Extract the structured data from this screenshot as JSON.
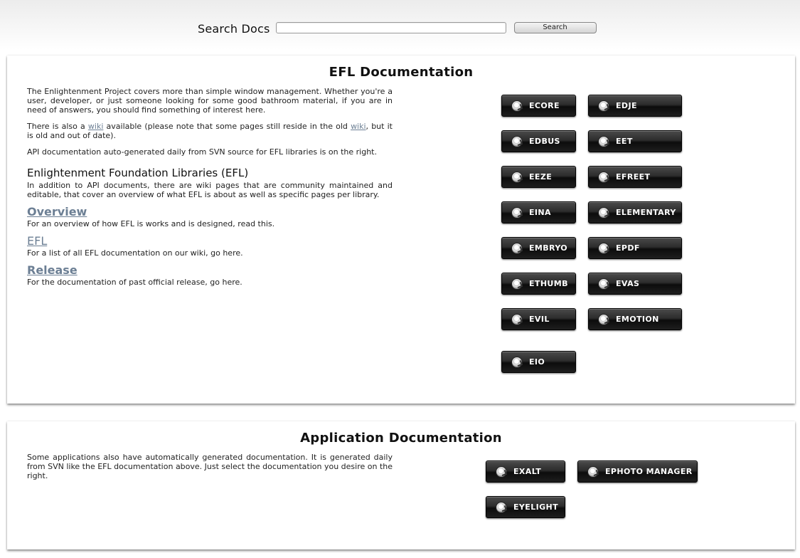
{
  "search": {
    "title": "Search Docs",
    "input_value": "",
    "input_placeholder": "",
    "button_label": "Search"
  },
  "efl_panel": {
    "title": "EFL Documentation",
    "intro_paragraph": "The Enlightenment Project covers more than simple window management. Whether you're a user, developer, or just someone looking for some good bathroom material, if you are in need of answers, you should find something of interest here.",
    "wiki_text_1": "There is also a ",
    "wiki_link_1": "wiki",
    "wiki_text_2": " available (please note that some pages still reside in the old ",
    "wiki_link_2": "wiki",
    "wiki_text_3": ", but it is old and out of date).",
    "api_paragraph": "API documentation auto-generated daily from SVN source for EFL libraries is on the right.",
    "efl_heading": "Enlightenment Foundation Libraries (EFL)",
    "efl_paragraph": "In addition to API documents, there are wiki pages that are community maintained and editable, that cover an overview of what EFL is about as well as specific pages per library.",
    "links": [
      {
        "label": "Overview",
        "desc": "For an overview of how EFL is works and is designed, read this."
      },
      {
        "label": "EFL",
        "desc": "For a list of all EFL documentation on our wiki, go here."
      },
      {
        "label": "Release",
        "desc": "For the documentation of past official release, go here."
      }
    ],
    "libraries": [
      "ECORE",
      "EDJE",
      "EDBUS",
      "EET",
      "EEZE",
      "EFREET",
      "EINA",
      "ELEMENTARY",
      "EMBRYO",
      "EPDF",
      "ETHUMB",
      "EVAS",
      "EVIL",
      "EMOTION",
      "EIO"
    ]
  },
  "app_panel": {
    "title": "Application Documentation",
    "paragraph": "Some applications also have automatically generated documentation. It is generated daily from SVN like the EFL documentation above. Just select the documentation you desire on the right.",
    "apps": [
      "EXALT",
      "EPHOTO MANAGER",
      "EYELIGHT"
    ]
  }
}
